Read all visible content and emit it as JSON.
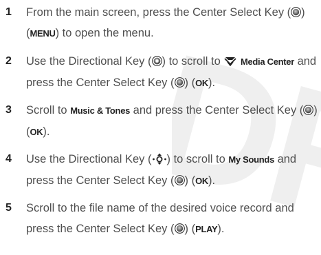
{
  "watermark": "DR",
  "steps": [
    {
      "num": "1",
      "t1": "From the main screen, press the Center Select Key (",
      "t2": ") (",
      "k1": "MENU",
      "t3": ") to open the menu."
    },
    {
      "num": "2",
      "t1": "Use the Directional Key (",
      "t2": ") to scroll to ",
      "k1": "Media Center",
      "t3": " and press the Center Select Key (",
      "t4": ") (",
      "k2": "OK",
      "t5": ")."
    },
    {
      "num": "3",
      "t1": "Scroll to ",
      "k1": "Music & Tones",
      "t2": " and press the Center Select Key (",
      "t3": ") (",
      "k2": "OK",
      "t4": ")."
    },
    {
      "num": "4",
      "t1": "Use the Directional Key (",
      "t2": ") to scroll to ",
      "k1": "My Sounds",
      "t3": " and press the Center Select Key (",
      "t4": ") (",
      "k2": "OK",
      "t5": ")."
    },
    {
      "num": "5",
      "t1": "Scroll to the file name of the desired voice record and press the Center Select Key (",
      "t2": ") (",
      "k1": "PLAY",
      "t3": ")."
    }
  ],
  "icons": {
    "center_select": "center-select-key-icon",
    "directional_ring": "directional-key-icon",
    "directional_arrows": "directional-arrows-icon",
    "media": "media-center-icon"
  }
}
